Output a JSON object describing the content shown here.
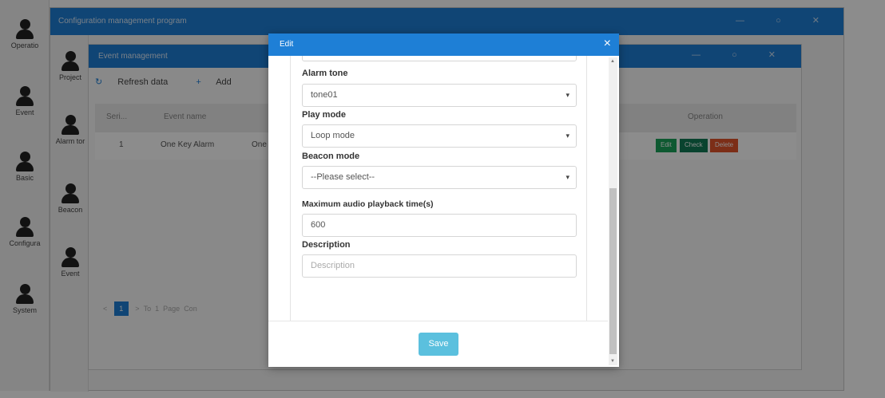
{
  "rail": {
    "items": [
      {
        "label": "Operatio",
        "icon": "user-icon"
      },
      {
        "label": "Event",
        "icon": "user-icon"
      },
      {
        "label": "Basic",
        "icon": "user-icon"
      },
      {
        "label": "Configura",
        "icon": "user-icon"
      },
      {
        "label": "System",
        "icon": "user-icon"
      }
    ]
  },
  "main_window": {
    "title": "Configuration management program",
    "sub_items": [
      {
        "label": "Project"
      },
      {
        "label": "Alarm tor"
      },
      {
        "label": "Beacon"
      },
      {
        "label": "Event"
      }
    ]
  },
  "event_window": {
    "title": "Event management",
    "toolbar": {
      "refresh": "Refresh data",
      "add": "Add",
      "refresh_icon": "refresh-icon",
      "add_icon": "plus-icon"
    },
    "table": {
      "headers": {
        "serial": "Seri...",
        "event_name": "Event name",
        "operation": "Operation"
      },
      "row": {
        "serial": "1",
        "event_name": "One Key Alarm",
        "trailing": "One"
      },
      "row_actions": {
        "edit": "Edit",
        "check": "Check",
        "delete": "Delete"
      }
    },
    "pager": {
      "prev": "<",
      "page": "1",
      "next": ">",
      "to": "To",
      "page_input": "1",
      "page_label": "Page",
      "confirm": "Con"
    }
  },
  "modal": {
    "title": "Edit",
    "close": "×",
    "fields": {
      "alarm_tone_label": "Alarm tone",
      "alarm_tone_value": "tone01",
      "play_mode_label": "Play mode",
      "play_mode_value": "Loop mode",
      "beacon_mode_label": "Beacon mode",
      "beacon_mode_value": "--Please select--",
      "max_time_label": "Maximum audio playback time(s)",
      "max_time_value": "600",
      "description_label": "Description",
      "description_placeholder": "Description"
    },
    "save": "Save"
  },
  "colors": {
    "accent": "#1e7fd6",
    "save": "#5bc0de",
    "edit": "#1aa35a",
    "check": "#117a56",
    "delete": "#e2542a"
  }
}
